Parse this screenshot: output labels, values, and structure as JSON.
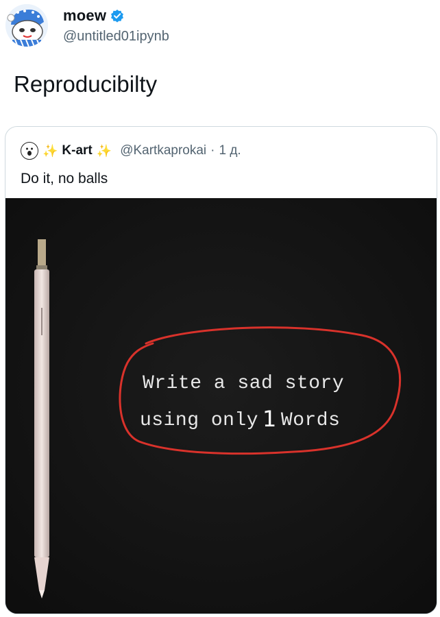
{
  "author": {
    "display_name": "moew",
    "handle": "@untitled01ipynb",
    "verified": true,
    "avatar_icon": "cartoon-character-avatar-icon"
  },
  "post": {
    "text": "Reproducibilty"
  },
  "quoted": {
    "display_name": "K-art",
    "sparkle": "✨",
    "handle": "@Kartkaprokai",
    "separator": "·",
    "time": "1 д.",
    "text": "Do it, no balls",
    "media": {
      "line1": "Write a sad story",
      "line2_prefix": "using only",
      "line2_number": "1",
      "line2_suffix": "Words"
    }
  },
  "colors": {
    "verified_blue": "#1d9bf0",
    "muted_text": "#536471",
    "annotation_red": "#d9322b"
  }
}
